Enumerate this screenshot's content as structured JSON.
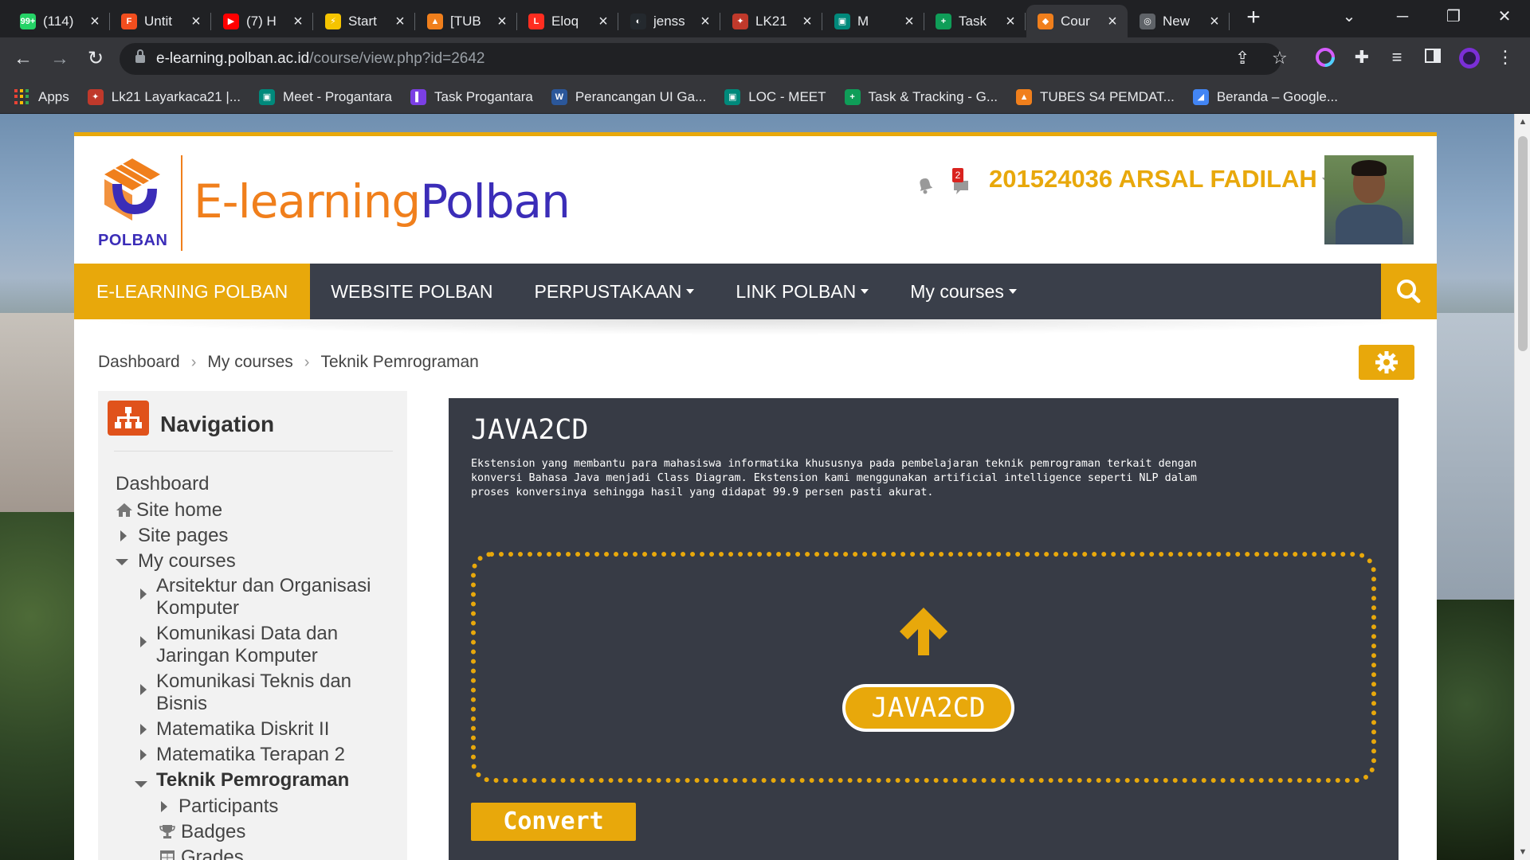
{
  "browser": {
    "tabs": [
      {
        "title": "(114)",
        "icon": "whatsapp-icon",
        "color": "#25d366",
        "glyph": "99+"
      },
      {
        "title": "Untit",
        "icon": "figma-icon",
        "color": "#f24e1e",
        "glyph": "F"
      },
      {
        "title": "(7) H",
        "icon": "youtube-icon",
        "color": "#ff0000",
        "glyph": "▶"
      },
      {
        "title": "Start",
        "icon": "startup-icon",
        "color": "#f5c400",
        "glyph": "⚡"
      },
      {
        "title": "[TUB",
        "icon": "tubes-icon",
        "color": "#f07f1c",
        "glyph": "▲"
      },
      {
        "title": "Eloq",
        "icon": "laravel-icon",
        "color": "#ff2d20",
        "glyph": "L"
      },
      {
        "title": "jenss",
        "icon": "github-icon",
        "color": "#24292e",
        "glyph": "◐"
      },
      {
        "title": "LK21",
        "icon": "lk21-icon",
        "color": "#c0392b",
        "glyph": "✦"
      },
      {
        "title": "M",
        "icon": "meet-icon",
        "color": "#00897b",
        "glyph": "▣"
      },
      {
        "title": "Task",
        "icon": "task-icon",
        "color": "#0f9d58",
        "glyph": "+"
      },
      {
        "title": "Cour",
        "icon": "polban-icon",
        "color": "#f07f1c",
        "glyph": "◆"
      },
      {
        "title": "New",
        "icon": "chrome-icon",
        "color": "#5f6368",
        "glyph": "◎"
      }
    ],
    "active_tab": 10,
    "url_host": "e-learning.polban.ac.id",
    "url_path": "/course/view.php?id=2642",
    "bookmarks": [
      {
        "label": "Apps",
        "icon": "apps-icon"
      },
      {
        "label": "Lk21 Layarkaca21 |...",
        "icon": "lk21-icon",
        "color": "#c0392b",
        "glyph": "✦"
      },
      {
        "label": "Meet - Progantara",
        "icon": "meet-icon",
        "color": "#00897b",
        "glyph": "▣"
      },
      {
        "label": "Task Progantara",
        "icon": "task-progantara-icon",
        "color": "#7b3fe4",
        "glyph": "▌"
      },
      {
        "label": "Perancangan UI Ga...",
        "icon": "word-icon",
        "color": "#2b579a",
        "glyph": "W"
      },
      {
        "label": "LOC - MEET",
        "icon": "meet-icon",
        "color": "#00897b",
        "glyph": "▣"
      },
      {
        "label": "Task & Tracking - G...",
        "icon": "sheets-icon",
        "color": "#0f9d58",
        "glyph": "+"
      },
      {
        "label": "TUBES S4 PEMDAT...",
        "icon": "tubes-icon",
        "color": "#f07f1c",
        "glyph": "▲"
      },
      {
        "label": "Beranda – Google...",
        "icon": "google-ads-icon",
        "color": "#4285f4",
        "glyph": "◢"
      }
    ]
  },
  "site": {
    "logo_text": "POLBAN",
    "brand_prefix": "E-learning",
    "brand_suffix": "Polban",
    "notification_count": "2",
    "username": "201524036 ARSAL FADILAH",
    "nav": {
      "home": "E-LEARNING POLBAN",
      "website": "WEBSITE POLBAN",
      "library": "PERPUSTAKAAN",
      "links": "LINK POLBAN",
      "courses": "My courses"
    },
    "breadcrumb": [
      "Dashboard",
      "My courses",
      "Teknik Pemrograman"
    ]
  },
  "navigation": {
    "title": "Navigation",
    "dashboard": "Dashboard",
    "site_home": "Site home",
    "site_pages": "Site pages",
    "my_courses": "My courses",
    "courses": [
      "Arsitektur dan Organisasi Komputer",
      "Komunikasi Data dan Jaringan Komputer",
      "Komunikasi Teknis dan Bisnis",
      "Matematika Diskrit II",
      "Matematika Terapan 2",
      "Teknik Pemrograman"
    ],
    "participants": "Participants",
    "badges": "Badges",
    "grades": "Grades"
  },
  "extension": {
    "title": "JAVA2CD",
    "description": "Ekstension yang membantu para mahasiswa informatika khususnya pada pembelajaran teknik pemrograman terkait dengan konversi Bahasa Java menjadi Class Diagram. Ekstension kami menggunakan artificial intelligence seperti NLP dalam proses konversinya sehingga hasil yang didapat 99.9 persen pasti akurat.",
    "upload_label": "JAVA2CD",
    "convert_label": "Convert"
  },
  "colors": {
    "accent": "#e8a80b",
    "nav_dark": "#3a3f4a",
    "panel": "#373b45",
    "brand_orange": "#f07f1c",
    "brand_purple": "#3b2db8"
  }
}
